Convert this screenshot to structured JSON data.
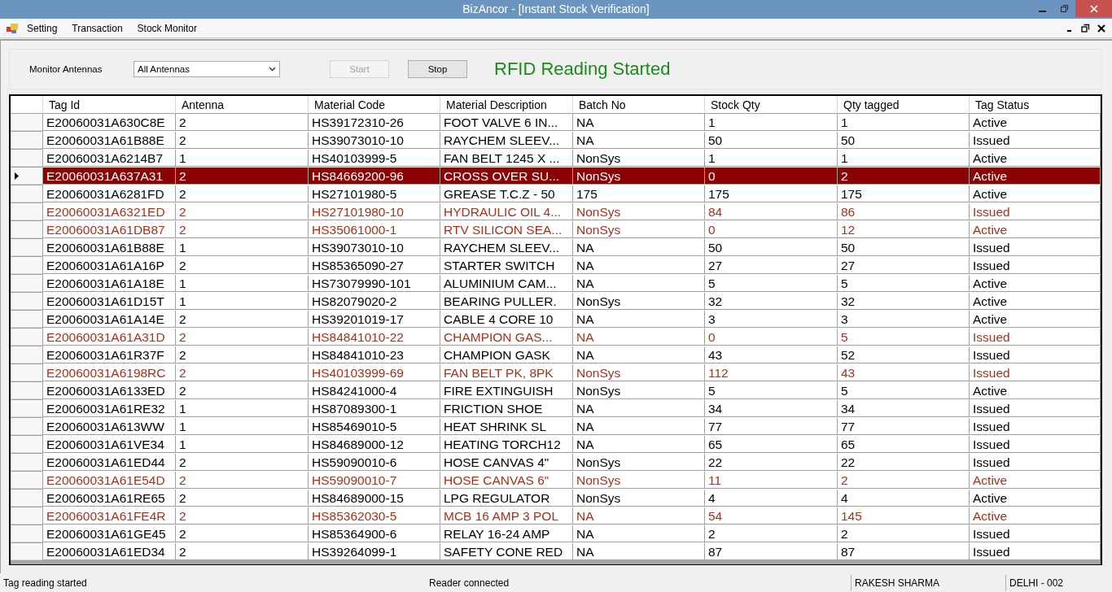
{
  "window": {
    "title": "BizAncor - [Instant Stock Verification]"
  },
  "menu": [
    "Setting",
    "Transaction",
    "Stock Monitor"
  ],
  "controls": {
    "antenna_label": "Monitor Antennas",
    "antenna_select": "All Antennas",
    "start": {
      "label": "Start",
      "disabled": true
    },
    "stop": {
      "label": "Stop",
      "disabled": false
    },
    "status_message": "RFID Reading Started"
  },
  "table": {
    "columns": [
      "Tag Id",
      "Antenna",
      "Material Code",
      "Material Description",
      "Batch No",
      "Stock Qty",
      "Qty tagged",
      "Tag Status"
    ],
    "rows": [
      {
        "cells": [
          "E20060031A630C8E",
          "2",
          "HS39172310-26",
          "FOOT VALVE 6 IN...",
          "NA",
          "1",
          "1",
          "Active"
        ],
        "selected": false,
        "flagged": false
      },
      {
        "cells": [
          "E20060031A61B88E",
          "2",
          "HS39073010-10",
          "RAYCHEM SLEEV...",
          "NA",
          "50",
          "50",
          "Issued"
        ],
        "selected": false,
        "flagged": false
      },
      {
        "cells": [
          "E20060031A6214B7",
          "1",
          "HS40103999-5",
          "FAN BELT 1245 X ...",
          "NonSys",
          "1",
          "1",
          "Active"
        ],
        "selected": false,
        "flagged": false
      },
      {
        "cells": [
          "E20060031A637A31",
          "2",
          "HS84669200-96",
          "CROSS OVER SU...",
          "NonSys",
          "0",
          "2",
          "Active"
        ],
        "selected": true,
        "flagged": false
      },
      {
        "cells": [
          "E20060031A6281FD",
          "2",
          "HS27101980-5",
          "GREASE T.C.Z - 50",
          "175",
          "175",
          "175",
          "Active"
        ],
        "selected": false,
        "flagged": false
      },
      {
        "cells": [
          "E20060031A6321ED",
          "2",
          "HS27101980-10",
          "HYDRAULIC OIL 4...",
          "NonSys",
          "84",
          "86",
          "Issued"
        ],
        "selected": false,
        "flagged": true
      },
      {
        "cells": [
          "E20060031A61DB87",
          "2",
          "HS35061000-1",
          "RTV SILICON SEA...",
          "NonSys",
          "0",
          "12",
          "Active"
        ],
        "selected": false,
        "flagged": true
      },
      {
        "cells": [
          "E20060031A61B88E",
          "1",
          "HS39073010-10",
          "RAYCHEM SLEEV...",
          "NA",
          "50",
          "50",
          "Issued"
        ],
        "selected": false,
        "flagged": false
      },
      {
        "cells": [
          "E20060031A61A16P",
          "2",
          "HS85365090-27",
          "STARTER SWITCH",
          "NA",
          "27",
          "27",
          "Issued"
        ],
        "selected": false,
        "flagged": false
      },
      {
        "cells": [
          "E20060031A61A18E",
          "1",
          "HS73079990-101",
          "ALUMINIUM CAM...",
          "NA",
          "5",
          "5",
          "Active"
        ],
        "selected": false,
        "flagged": false
      },
      {
        "cells": [
          "E20060031A61D15T",
          "1",
          "HS82079020-2",
          "BEARING PULLER.",
          "NonSys",
          "32",
          "32",
          "Active"
        ],
        "selected": false,
        "flagged": false
      },
      {
        "cells": [
          "E20060031A61A14E",
          "2",
          "HS39201019-17",
          "CABLE 4 CORE 10",
          "NA",
          "3",
          "3",
          "Active"
        ],
        "selected": false,
        "flagged": false
      },
      {
        "cells": [
          "E20060031A61A31D",
          "2",
          "HS84841010-22",
          "CHAMPION GAS...",
          "NA",
          "0",
          "5",
          "Issued"
        ],
        "selected": false,
        "flagged": true
      },
      {
        "cells": [
          "E20060031A61R37F",
          "2",
          "HS84841010-23",
          "CHAMPION GASK",
          "NA",
          "43",
          "52",
          "Issued"
        ],
        "selected": false,
        "flagged": false
      },
      {
        "cells": [
          "E20060031A6198RC",
          "2",
          "HS40103999-69",
          "FAN BELT PK, 8PK",
          "NonSys",
          "112",
          "43",
          "Issued"
        ],
        "selected": false,
        "flagged": true
      },
      {
        "cells": [
          "E20060031A6133ED",
          "2",
          "HS84241000-4",
          "FIRE EXTINGUISH",
          "NonSys",
          "5",
          "5",
          "Active"
        ],
        "selected": false,
        "flagged": false
      },
      {
        "cells": [
          "E20060031A61RE32",
          "1",
          "HS87089300-1",
          "FRICTION SHOE",
          "NA",
          "34",
          "34",
          "Issued"
        ],
        "selected": false,
        "flagged": false
      },
      {
        "cells": [
          "E20060031A613WW",
          "1",
          "HS85469010-5",
          "HEAT SHRINK SL",
          "NA",
          "77",
          "77",
          "Issued"
        ],
        "selected": false,
        "flagged": false
      },
      {
        "cells": [
          "E20060031A61VE34",
          "1",
          "HS84689000-12",
          "HEATING TORCH12",
          "NA",
          "65",
          "65",
          "Issued"
        ],
        "selected": false,
        "flagged": false
      },
      {
        "cells": [
          "E20060031A61ED44",
          "2",
          "HS59090010-6",
          "HOSE CANVAS 4\"",
          "NonSys",
          "22",
          "22",
          "Issued"
        ],
        "selected": false,
        "flagged": false
      },
      {
        "cells": [
          "E20060031A61E54D",
          "2",
          "HS59090010-7",
          "HOSE CANVAS 6\"",
          "NonSys",
          "11",
          "2",
          "Active"
        ],
        "selected": false,
        "flagged": true
      },
      {
        "cells": [
          "E20060031A61RE65",
          "2",
          "HS84689000-15",
          "LPG REGULATOR",
          "NonSys",
          "4",
          "4",
          "Active"
        ],
        "selected": false,
        "flagged": false
      },
      {
        "cells": [
          "E20060031A61FE4R",
          "2",
          "HS85362030-5",
          "MCB 16 AMP 3 POL",
          "NA",
          "54",
          "145",
          "Active"
        ],
        "selected": false,
        "flagged": true
      },
      {
        "cells": [
          "E20060031A61GE45",
          "2",
          "HS85364900-6",
          "RELAY 16-24 AMP",
          "NA",
          "2",
          "2",
          "Issued"
        ],
        "selected": false,
        "flagged": false
      },
      {
        "cells": [
          "E20060031A61ED34",
          "2",
          "HS39264099-1",
          "SAFETY CONE RED",
          "NA",
          "87",
          "87",
          "Issued"
        ],
        "selected": false,
        "flagged": false
      }
    ]
  },
  "status_bar": [
    "Tag reading started",
    "Reader connected",
    "RAKESH SHARMA",
    "DELHI - 002"
  ]
}
